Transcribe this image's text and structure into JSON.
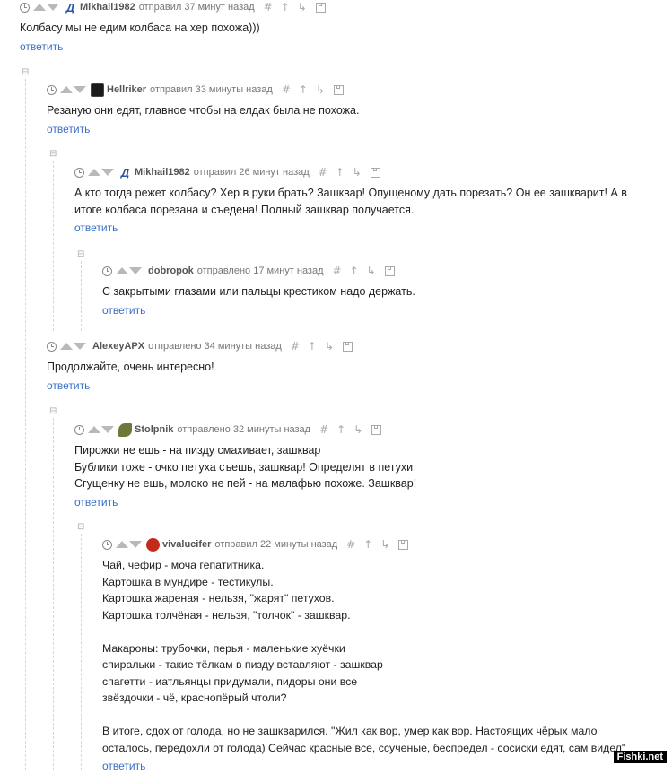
{
  "comments": [
    {
      "username": "Mikhail1982",
      "action_time": "отправил 37 минут назад",
      "text": "Колбасу мы не едим колбаса на хер похожа)))",
      "reply_label": "ответить",
      "avatar": "dynamo-icon"
    },
    {
      "username": "Hellriker",
      "action_time": "отправил 33 минуты назад",
      "text": "Резаную они едят, главное чтобы на елдак была не похожа.",
      "reply_label": "ответить",
      "avatar": "dark-avatar"
    },
    {
      "username": "Mikhail1982",
      "action_time": "отправил 26 минут назад",
      "text": "А кто тогда режет колбасу?   Хер в руки брать? Зашквар! Опущеному дать порезать? Он ее зашкварит! А в\nитоге колбаса порезана и съедена! Полный зашквар получается.",
      "reply_label": "ответить",
      "avatar": "dynamo-icon"
    },
    {
      "username": "dobropok",
      "action_time": "отправлено 17 минут назад",
      "text": "С закрытыми глазами или пальцы крестиком надо держать.",
      "reply_label": "ответить",
      "avatar": ""
    },
    {
      "username": "AlexeyAPX",
      "action_time": "отправлено 34 минуты назад",
      "text": "Продолжайте, очень интересно!",
      "reply_label": "ответить",
      "avatar": ""
    },
    {
      "username": "Stolpnik",
      "action_time": "отправлено 32 минуты назад",
      "text": "Пирожки не ешь - на пизду смахивает, зашквар\nБублики тоже - очко петуха съешь, зашквар! Определят в петухи\nСгущенку не ешь, молоко не пей - на малафью похоже. Зашквар!",
      "reply_label": "ответить",
      "avatar": "dragon-avatar"
    },
    {
      "username": "vivalucifer",
      "action_time": "отправил 22 минуты назад",
      "text": "Чай, чефир - моча гепатитника.\nКартошка в мундире - тестикулы.\nКартошка жареная - нельзя, \"жарят\" петухов.\nКартошка толчёная - нельзя, \"толчок\" - зашквар.\n\nМакароны: трубочки, перья - маленькие хуёчки\nспиральки - такие тёлкам в пизду вставляют - зашквар\nспагетти - иатльянцы придумали, пидоры они все\nзвёздочки - чё, краснопёрый чтоли?\n\nВ итоге, сдох от голода, но не зашкварился. \"Жил как вор, умер как вор. Настоящих чёрых мало\nосталось, передохли от голода) Сейчас красные все, ссученые, беспредел - сосиски едят, сам видел\"",
      "reply_label": "ответить",
      "avatar": "devil-avatar"
    }
  ],
  "meta_icons": [
    "hash-icon",
    "up-arrow-icon",
    "branch-icon",
    "save-icon"
  ],
  "collapse_symbol": "⊟",
  "watermark": "Fishki.net",
  "colors": {
    "link": "#3a6fc1",
    "muted": "#777777",
    "username": "#555555"
  }
}
